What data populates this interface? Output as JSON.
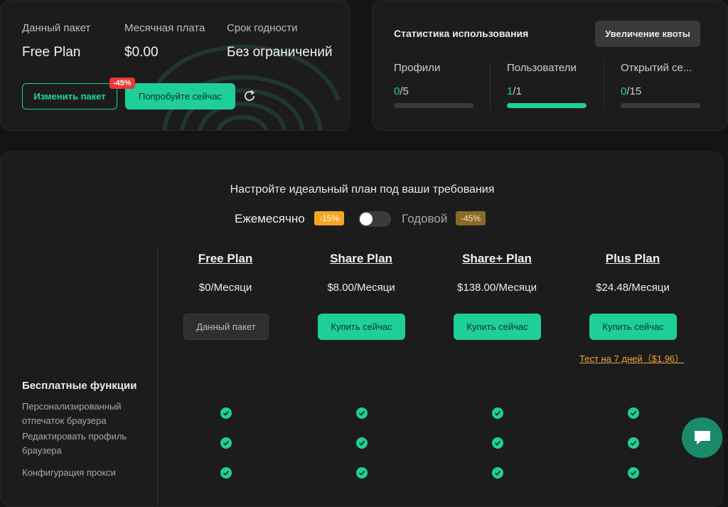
{
  "current_plan": {
    "package_label": "Данный пакет",
    "package_value": "Free Plan",
    "monthly_fee_label": "Месячная плата",
    "monthly_fee_value": "$0.00",
    "validity_label": "Срок годности",
    "validity_value": "Без ограничений",
    "change_button": "Изменить пакет",
    "try_button": "Попробуйте сейчас",
    "try_badge": "-45%"
  },
  "stats": {
    "title": "Статистика использования",
    "increase_button": "Увеличение квоты",
    "items": [
      {
        "name": "Профили",
        "used": "0",
        "total": "/5",
        "progress": 0
      },
      {
        "name": "Пользователи",
        "used": "1",
        "total": "/1",
        "progress": 1
      },
      {
        "name": "Открытий се...",
        "used": "0",
        "total": "/15",
        "progress": 0
      }
    ]
  },
  "pricing": {
    "headline": "Настройте идеальный план под ваши требования",
    "monthly_label": "Ежемесячно",
    "monthly_discount": "-15%",
    "yearly_label": "Годовой",
    "yearly_discount": "-45%",
    "billing_toggle_on": false,
    "plans": [
      {
        "name": "Free Plan",
        "price": "$0/Месяци",
        "button": "Данный пакет"
      },
      {
        "name": "Share Plan",
        "price": "$8.00/Месяци",
        "button": "Купить сейчас"
      },
      {
        "name": "Share+ Plan",
        "price": "$138.00/Месяци",
        "button": "Купить сейчас"
      },
      {
        "name": "Plus Plan",
        "price": "$24.48/Месяци",
        "button": "Купить сейчас"
      }
    ],
    "trial_link": "Тест на 7 дней（$1.96）",
    "features_title": "Бесплатные функции",
    "features": [
      "Персонализированный отпечаток браузера",
      "Редактировать профиль браузера",
      "Конфигурация прокси"
    ]
  },
  "colors": {
    "accent": "#1fcf9a",
    "badge_red": "#e53935",
    "discount_orange": "#f5a623",
    "discount_brown": "#8a6a2a"
  }
}
